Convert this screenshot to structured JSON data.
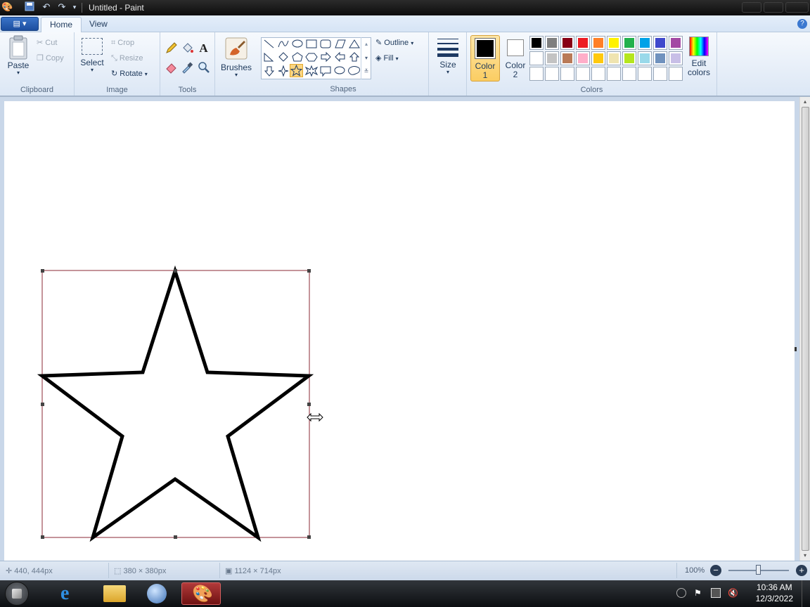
{
  "window": {
    "title": "Untitled - Paint"
  },
  "tabs": [
    {
      "label": "Home",
      "active": true
    },
    {
      "label": "View",
      "active": false
    }
  ],
  "ribbon": {
    "clipboard": {
      "paste": "Paste",
      "cut": "Cut",
      "copy": "Copy",
      "group": "Clipboard"
    },
    "image": {
      "select": "Select",
      "crop": "Crop",
      "resize": "Resize",
      "rotate": "Rotate",
      "group": "Image"
    },
    "tools": {
      "group": "Tools"
    },
    "brushes": {
      "label": "Brushes"
    },
    "shapes": {
      "outline": "Outline",
      "fill": "Fill",
      "group": "Shapes",
      "selected": "five-point-star"
    },
    "size": {
      "label": "Size"
    },
    "colors": {
      "color1_label": "Color",
      "color1_num": "1",
      "color2_label": "Color",
      "color2_num": "2",
      "color1": "#000000",
      "color2": "#ffffff",
      "group": "Colors",
      "edit_label": "Edit",
      "edit_label2": "colors",
      "palette_row1": [
        "#000000",
        "#7f7f7f",
        "#880015",
        "#ed1c24",
        "#ff7f27",
        "#fff200",
        "#22b14c",
        "#00a2e8",
        "#3f48cc",
        "#a349a4"
      ],
      "palette_row2": [
        "#ffffff",
        "#c3c3c3",
        "#b97a57",
        "#ffaec9",
        "#ffc90e",
        "#efe4b0",
        "#b5e61d",
        "#99d9ea",
        "#7092be",
        "#c8bfe7"
      ],
      "palette_row3": [
        "",
        "",
        "",
        "",
        "",
        "",
        "",
        "",
        "",
        ""
      ]
    }
  },
  "status": {
    "cursor_pos": "440, 444px",
    "selection_size": "380 × 380px",
    "canvas_size": "1124 × 714px",
    "zoom": "100%"
  },
  "taskbar": {
    "time": "10:36 AM",
    "date": "12/3/2022"
  }
}
